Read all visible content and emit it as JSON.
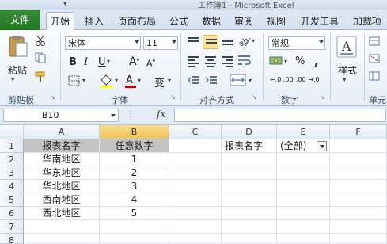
{
  "app": {
    "title": "工作簿1 - Microsoft Excel",
    "quick_access": "▾"
  },
  "tabs": {
    "file": "文件",
    "items": [
      "开始",
      "插入",
      "页面布局",
      "公式",
      "数据",
      "审阅",
      "视图",
      "开发工具",
      "加载项"
    ],
    "active": "开始"
  },
  "ribbon": {
    "clipboard": {
      "paste": "粘贴",
      "label": "剪贴板"
    },
    "font": {
      "name": "宋体",
      "size": "11",
      "bold": "B",
      "italic": "I",
      "underline": "U",
      "grow": "A",
      "shrink": "A",
      "phonetic": "变",
      "label": "字体",
      "font_color": "#c00000",
      "fill_color": "#ffff00"
    },
    "alignment": {
      "label": "对齐方式"
    },
    "number": {
      "format": "常规",
      "percent": "%",
      "comma": ",",
      "dec_inc": "←.0 .00",
      "dec_dec": ".00 →.0",
      "label": "数字"
    },
    "styles": {
      "label": "样式"
    },
    "cells": {
      "label": "单元"
    }
  },
  "formula_bar": {
    "name_box": "B10",
    "fx": "fx",
    "formula": ""
  },
  "sheet": {
    "columns": [
      "A",
      "B",
      "C",
      "D",
      "E",
      "F"
    ],
    "selected_column": "B",
    "rows": [
      "1",
      "2",
      "3",
      "4",
      "5",
      "6",
      "7",
      "8"
    ],
    "header": {
      "a": "报表名字",
      "b": "任意数字"
    },
    "data": [
      {
        "a": "华南地区",
        "b": "1"
      },
      {
        "a": "华东地区",
        "b": "2"
      },
      {
        "a": "华北地区",
        "b": "3"
      },
      {
        "a": "西南地区",
        "b": "4"
      },
      {
        "a": "西北地区",
        "b": "5"
      }
    ],
    "filter": {
      "label": "报表名字",
      "value": "(全部)"
    }
  }
}
